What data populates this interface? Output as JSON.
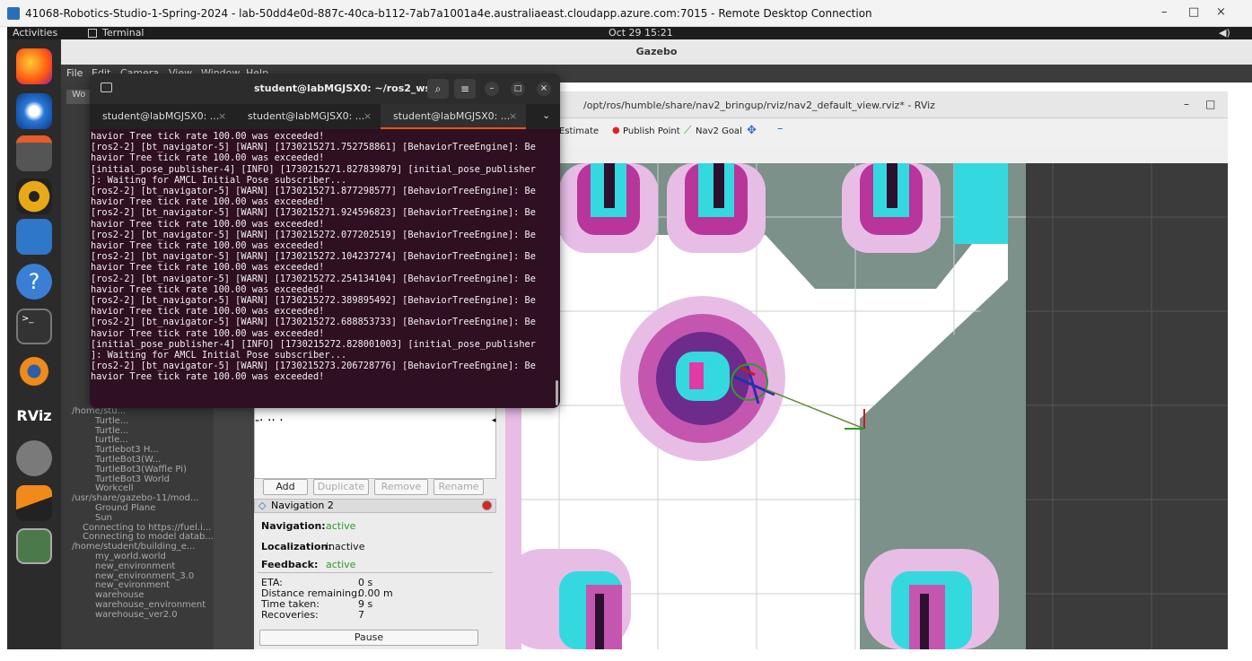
{
  "rdp": {
    "title": "41068-Robotics-Studio-1-Spring-2024 - lab-50dd4e0d-887c-40ca-b112-7ab7a1001a4e.australiaeast.cloudapp.azure.com:7015 - Remote Desktop Connection",
    "minimize": "–",
    "maximize": "□",
    "close": "×"
  },
  "topbar": {
    "activities": "Activities",
    "app": "Terminal",
    "clock": "Oct 29  15:21"
  },
  "gazebo": {
    "title": "Gazebo",
    "menu": [
      "File",
      "Edit",
      "Camera",
      "View",
      "Window",
      "Help"
    ],
    "world_tab": "Wo",
    "tree": [
      "/home/stu...",
      "Turtle...",
      "Turtle...",
      "turtle...",
      "Turtlebot3 H...",
      "TurtleBot3(W...",
      "TurtleBot3(Waffle Pi)",
      "TurtleBot3 World",
      "Workcell",
      "/usr/share/gazebo-11/mod...",
      "Ground Plane",
      "Sun",
      "Connecting to https://fuel.i...",
      "Connecting to model datab...",
      "/home/student/building_e...",
      "my_world.world",
      "new_environment",
      "new_environment_3.0",
      "new_evironment",
      "warehouse",
      "warehouse_environment",
      "warehouse_ver2.0"
    ]
  },
  "rviz": {
    "title": "/opt/ros/humble/share/nav2_bringup/rviz/nav2_default_view.rviz* - RViz",
    "tools": {
      "estimate": "Estimate",
      "publish_point": "Publish Point",
      "nav2_goal": "Nav2 Goal"
    },
    "panel_buttons": {
      "add": "Add",
      "duplicate": "Duplicate",
      "remove": "Remove",
      "rename": "Rename"
    },
    "nav_panel": {
      "title": "Navigation 2",
      "navigation_label": "Navigation:",
      "navigation_value": "active",
      "localization_label": "Localization:",
      "localization_value": "inactive",
      "feedback_label": "Feedback:",
      "feedback_value": "active",
      "eta_label": "ETA:",
      "eta_value": "0 s",
      "dist_label": "Distance remaining:",
      "dist_value": "0.00 m",
      "time_label": "Time taken:",
      "time_value": "9 s",
      "rec_label": "Recoveries:",
      "rec_value": "7",
      "pause": "Pause"
    }
  },
  "terminal": {
    "title": "student@labMGJSX0: ~/ros2_ws",
    "tabs": [
      "student@labMGJSX0: ...",
      "student@labMGJSX0: ...",
      "student@labMGJSX0: ..."
    ],
    "lines": [
      "havior Tree tick rate 100.00 was exceeded!",
      "[ros2-2] [bt_navigator-5] [WARN] [1730215271.752758861] [BehaviorTreeEngine]: Be",
      "havior Tree tick rate 100.00 was exceeded!",
      "[initial_pose_publisher-4] [INFO] [1730215271.827839879] [initial_pose_publisher",
      "]: Waiting for AMCL Initial Pose subscriber...",
      "[ros2-2] [bt_navigator-5] [WARN] [1730215271.877298577] [BehaviorTreeEngine]: Be",
      "havior Tree tick rate 100.00 was exceeded!",
      "[ros2-2] [bt_navigator-5] [WARN] [1730215271.924596823] [BehaviorTreeEngine]: Be",
      "havior Tree tick rate 100.00 was exceeded!",
      "[ros2-2] [bt_navigator-5] [WARN] [1730215272.077202519] [BehaviorTreeEngine]: Be",
      "havior Tree tick rate 100.00 was exceeded!",
      "[ros2-2] [bt_navigator-5] [WARN] [1730215272.104237274] [BehaviorTreeEngine]: Be",
      "havior Tree tick rate 100.00 was exceeded!",
      "[ros2-2] [bt_navigator-5] [WARN] [1730215272.254134104] [BehaviorTreeEngine]: Be",
      "havior Tree tick rate 100.00 was exceeded!",
      "[ros2-2] [bt_navigator-5] [WARN] [1730215272.389895492] [BehaviorTreeEngine]: Be",
      "havior Tree tick rate 100.00 was exceeded!",
      "[ros2-2] [bt_navigator-5] [WARN] [1730215272.688853733] [BehaviorTreeEngine]: Be",
      "havior Tree tick rate 100.00 was exceeded!",
      "[initial_pose_publisher-4] [INFO] [1730215272.828001003] [initial_pose_publisher",
      "]: Waiting for AMCL Initial Pose subscriber...",
      "[ros2-2] [bt_navigator-5] [WARN] [1730215273.206728776] [BehaviorTreeEngine]: Be",
      "havior Tree tick rate 100.00 was exceeded!"
    ]
  },
  "dock": {
    "rviz_label": "RViz"
  }
}
